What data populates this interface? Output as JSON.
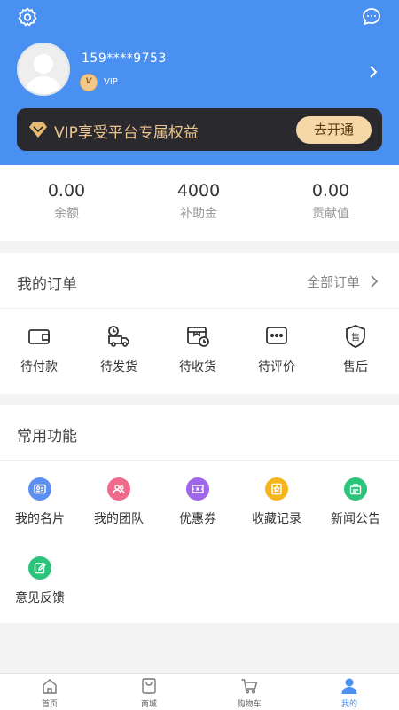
{
  "header": {
    "phone": "159****9753",
    "vip_badge_text": "V",
    "vip_label": "VIP",
    "banner_text": "VIP享受平台专属权益",
    "activate_button": "去开通"
  },
  "stats": [
    {
      "value": "0.00",
      "label": "余额"
    },
    {
      "value": "4000",
      "label": "补助金"
    },
    {
      "value": "0.00",
      "label": "贡献值"
    }
  ],
  "orders": {
    "title": "我的订单",
    "all_label": "全部订单",
    "items": [
      {
        "label": "待付款",
        "icon": "wallet-icon"
      },
      {
        "label": "待发货",
        "icon": "delivery-truck-icon"
      },
      {
        "label": "待收货",
        "icon": "receive-box-icon"
      },
      {
        "label": "待评价",
        "icon": "comment-icon"
      },
      {
        "label": "售后",
        "icon": "after-sale-shield-icon"
      }
    ]
  },
  "features": {
    "title": "常用功能",
    "items": [
      {
        "label": "我的名片",
        "icon": "card-icon",
        "color": "#5b8ff2"
      },
      {
        "label": "我的团队",
        "icon": "team-icon",
        "color": "#f06a8c"
      },
      {
        "label": "优惠券",
        "icon": "coupon-icon",
        "color": "#a066e8"
      },
      {
        "label": "收藏记录",
        "icon": "favorite-icon",
        "color": "#f5b51c"
      },
      {
        "label": "新闻公告",
        "icon": "news-icon",
        "color": "#2cc47a"
      },
      {
        "label": "意见反馈",
        "icon": "feedback-icon",
        "color": "#2cc47a"
      }
    ]
  },
  "tabbar": [
    {
      "label": "首页",
      "icon": "home-icon"
    },
    {
      "label": "商城",
      "icon": "mall-icon"
    },
    {
      "label": "购物车",
      "icon": "cart-icon"
    },
    {
      "label": "我的",
      "icon": "user-icon",
      "active": true
    }
  ],
  "colors": {
    "brand_blue": "#4a90f0",
    "vip_gold": "#ecc594",
    "banner_dark": "#2a2a2e"
  }
}
